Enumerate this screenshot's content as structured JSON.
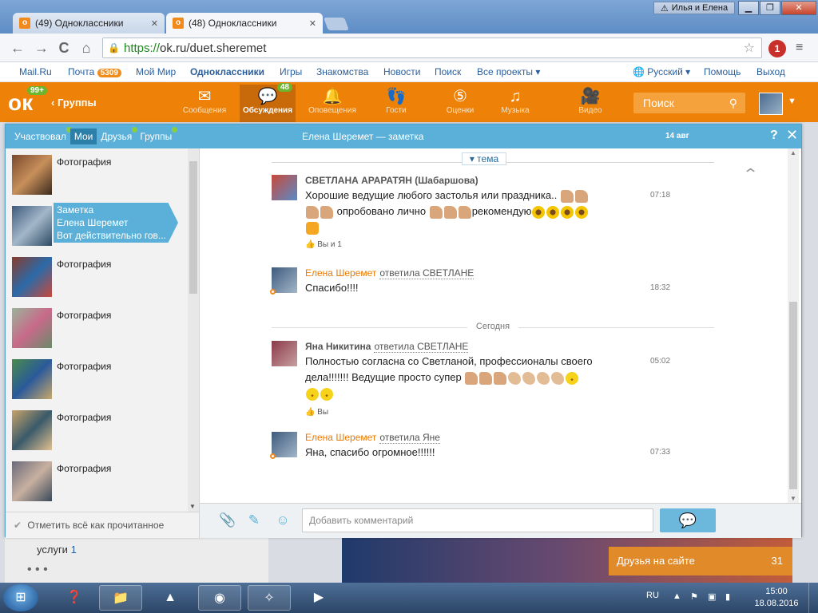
{
  "browser": {
    "tabs": [
      {
        "label": "(49) Одноклассники",
        "active": false
      },
      {
        "label": "(48) Одноклассники",
        "active": true
      }
    ],
    "user": "Илья и Елена",
    "window_buttons": {
      "min": "▁",
      "max": "❐",
      "close": "✕"
    },
    "url_scheme": "https://",
    "url_rest": "ok.ru/duet.sheremet",
    "icons": {
      "back": "←",
      "forward": "→",
      "reload": "C",
      "home": "⌂",
      "star": "☆",
      "menu": "≡",
      "ext": "1"
    }
  },
  "topbar": {
    "mailru": "Mail.Ru",
    "mail": "Почта",
    "mail_count": "5309",
    "moimir": "Мой Мир",
    "ok": "Одноклассники",
    "games": "Игры",
    "dating": "Знакомства",
    "news": "Новости",
    "search": "Поиск",
    "all_projects": "Все проекты ▾",
    "lang": "Русский ▾",
    "help": "Помощь",
    "logout": "Выход"
  },
  "okbar": {
    "logo": "ок",
    "logo_count": "99+",
    "groups": "Группы",
    "nav": [
      {
        "label": "Сообщения",
        "icon": "✉"
      },
      {
        "label": "Обсуждения",
        "icon": "💬",
        "count": "48"
      },
      {
        "label": "Оповещения",
        "icon": "🔔"
      },
      {
        "label": "Гости",
        "icon": "👣"
      },
      {
        "label": "Оценки",
        "icon": "⑤"
      },
      {
        "label": "Музыка",
        "icon": "♫"
      },
      {
        "label": "Видео",
        "icon": "🎥"
      }
    ],
    "search_placeholder": "Поиск",
    "search_icon": "⚲"
  },
  "left": {
    "tabs": [
      "Участвовал",
      "Мои",
      "Друзья",
      "Группы"
    ],
    "items": [
      {
        "title": "Фотография"
      },
      {
        "line1": "Заметка",
        "line2": "Елена Шеремет",
        "line3": "Вот действительно гов..."
      },
      {
        "title": "Фотография"
      },
      {
        "title": "Фотография"
      },
      {
        "title": "Фотография"
      },
      {
        "title": "Фотография"
      },
      {
        "title": "Фотография"
      }
    ],
    "mark_all": "Отметить всё как прочитанное",
    "mark_icon": "✔"
  },
  "right": {
    "title": "Елена Шеремет — заметка",
    "date": "14 авг",
    "help": "?",
    "close": "✕",
    "topic": "▾ тема",
    "today": "Сегодня",
    "messages": [
      {
        "author": "СВЕТЛАНА АРАРАТЯН (Шабаршова)",
        "text1": "Хорошие ведущие любого застолья или праздника..",
        "text2": "опробовано лично",
        "text3": "рекомендую",
        "time": "07:18",
        "likes": "Вы и 1"
      },
      {
        "author": "Елена Шеремет",
        "reply": "ответила СВЕТЛАНЕ",
        "text": "Спасибо!!!!",
        "time": "18:32"
      },
      {
        "author": "Яна Никитина",
        "reply": "ответила СВЕТЛАНЕ",
        "text1": "Полностью согласна со Светланой, профессионалы своего",
        "text2": "дела!!!!!!! Ведущие просто супер",
        "time": "05:02",
        "likes": "Вы"
      },
      {
        "author": "Елена Шеремет",
        "reply": "ответила Яне",
        "text": "Яна, спасибо огромное!!!!!!",
        "time": "07:33"
      }
    ],
    "composer_placeholder": "Добавить комментарий"
  },
  "background": {
    "services": "услуги",
    "services_count": "1",
    "friends_online": "Друзья на сайте",
    "friends_count": "31"
  },
  "taskbar": {
    "lang": "RU",
    "time": "15:00",
    "date": "18.08.2016"
  }
}
